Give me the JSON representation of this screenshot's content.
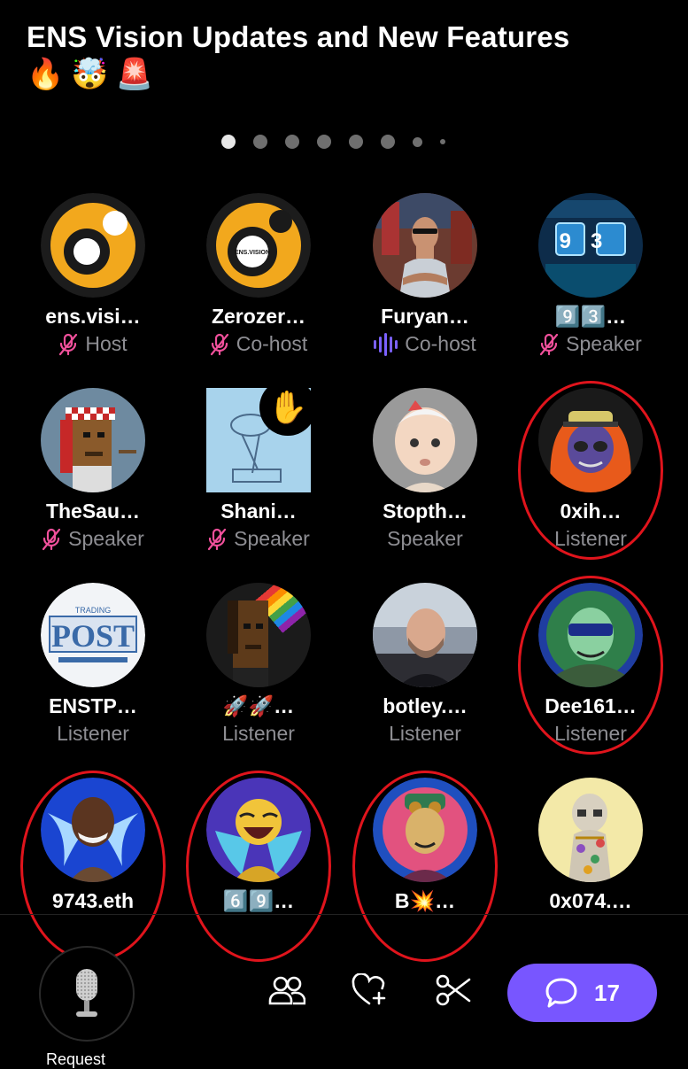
{
  "space": {
    "title": "ENS Vision Updates and New Features",
    "title_emojis": [
      "🔥",
      "🤯",
      "🚨"
    ]
  },
  "pager": {
    "total": 8,
    "active_index": 0
  },
  "participants": [
    {
      "name": "ens.visi…",
      "role": "Host",
      "muted": true,
      "speaking": false,
      "hand": false,
      "circled": false,
      "avatar": "ens-logo-yellow"
    },
    {
      "name": "Zerozer…",
      "role": "Co-host",
      "muted": true,
      "speaking": false,
      "hand": false,
      "circled": false,
      "avatar": "ens-logo-text",
      "avatar_text": "ENS.VISION"
    },
    {
      "name": "Furyan…",
      "role": "Co-host",
      "muted": false,
      "speaking": true,
      "hand": false,
      "circled": false,
      "avatar": "photo-man"
    },
    {
      "name": "9️⃣3️⃣…",
      "role": "Speaker",
      "muted": true,
      "speaking": false,
      "hand": false,
      "circled": false,
      "avatar": "neon-93",
      "avatar_text": "9 3"
    },
    {
      "name": "TheSau…",
      "role": "Speaker",
      "muted": true,
      "speaking": false,
      "hand": false,
      "circled": false,
      "avatar": "pixel-keffiyeh"
    },
    {
      "name": "Shani…",
      "role": "Speaker",
      "muted": true,
      "speaking": false,
      "hand": true,
      "circled": false,
      "avatar": "sketch-blue"
    },
    {
      "name": "Stopth…",
      "role": "Speaker",
      "muted": false,
      "speaking": false,
      "hand": false,
      "circled": false,
      "avatar": "baby-3d"
    },
    {
      "name": "0xih…",
      "role": "Listener",
      "muted": false,
      "speaking": false,
      "hand": false,
      "circled": true,
      "avatar": "cartoon-orange"
    },
    {
      "name": "ENSTP…",
      "role": "Listener",
      "muted": false,
      "speaking": false,
      "hand": false,
      "circled": false,
      "avatar": "trading-post",
      "avatar_text": "POST",
      "avatar_subtext": "TRADING"
    },
    {
      "name": "🚀🚀…",
      "role": "Listener",
      "muted": false,
      "speaking": false,
      "hand": false,
      "circled": false,
      "avatar": "pixel-rainbow"
    },
    {
      "name": "botley.…",
      "role": "Listener",
      "muted": false,
      "speaking": false,
      "hand": false,
      "circled": false,
      "avatar": "photo-bald"
    },
    {
      "name": "Dee161…",
      "role": "Listener",
      "muted": false,
      "speaking": false,
      "hand": false,
      "circled": true,
      "avatar": "cartoon-green"
    },
    {
      "name": "9743.eth",
      "role": "",
      "muted": false,
      "speaking": false,
      "hand": false,
      "circled": true,
      "avatar": "cartoon-blue-wings"
    },
    {
      "name": "6️⃣9️⃣…",
      "role": "",
      "muted": false,
      "speaking": false,
      "hand": false,
      "circled": true,
      "avatar": "cartoon-yellow-laugh"
    },
    {
      "name": "B💥…",
      "role": "",
      "muted": false,
      "speaking": false,
      "hand": false,
      "circled": true,
      "avatar": "cartoon-pink"
    },
    {
      "name": "0x074.…",
      "role": "",
      "muted": false,
      "speaking": false,
      "hand": false,
      "circled": false,
      "avatar": "ape-pale"
    }
  ],
  "toolbar": {
    "request_label": "Request",
    "icons": [
      "people-icon",
      "heart-plus-icon",
      "scissors-icon"
    ],
    "chat_count": "17"
  },
  "colors": {
    "accent": "#7856ff",
    "muted_mic": "#f0509b",
    "speaking": "#7b61ff",
    "annotation": "#e0141c"
  }
}
